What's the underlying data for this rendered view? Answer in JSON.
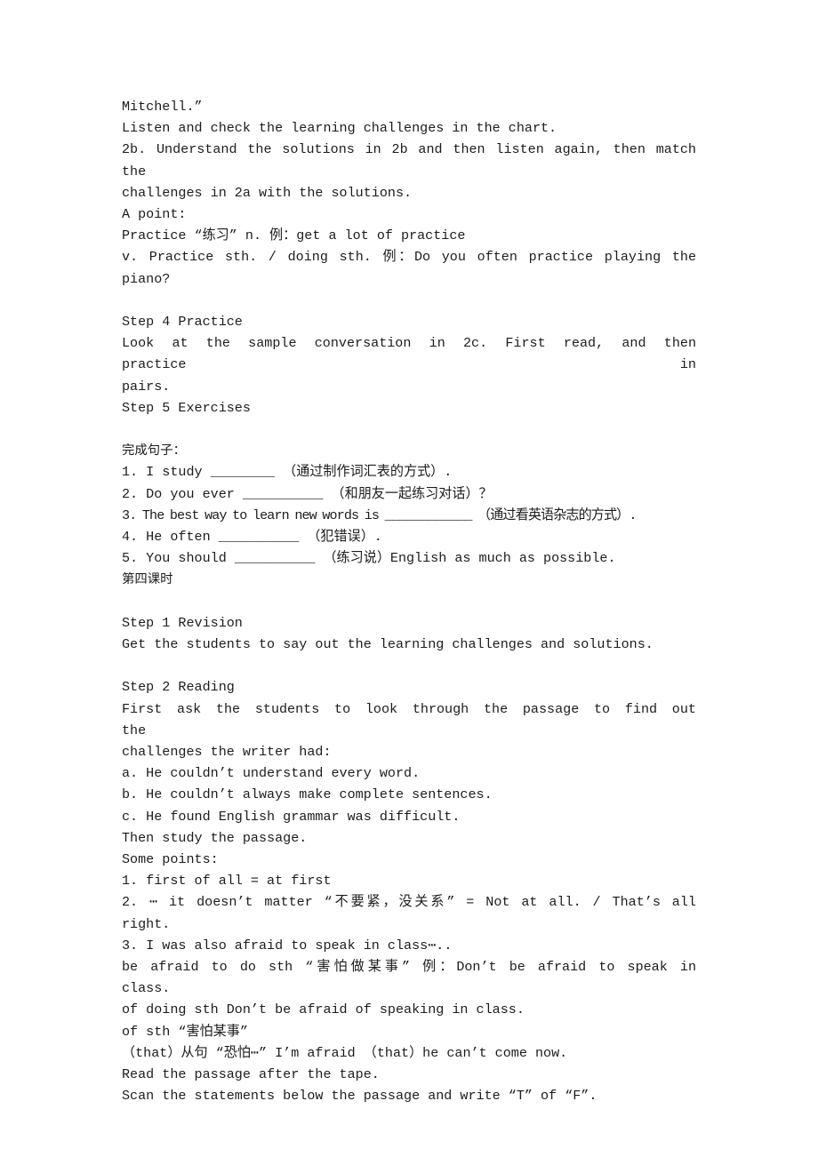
{
  "document": {
    "type": "lesson-plan",
    "language": "en-zh",
    "background_color": "#ffffff",
    "text_color": "#1c1c1c",
    "lines": [
      {
        "id": "l01",
        "text": "Mitchell.”",
        "style": "plain"
      },
      {
        "id": "l02",
        "text": "Listen and check the learning challenges in the chart.",
        "style": "plain"
      },
      {
        "id": "l03",
        "text": "2b. Understand the solutions in 2b and then listen again, then match the",
        "style": "justified-tight"
      },
      {
        "id": "l04",
        "text": "challenges in 2a with the solutions.",
        "style": "plain"
      },
      {
        "id": "l05",
        "text": "A point:",
        "style": "plain"
      },
      {
        "id": "l06",
        "text": "Practice “练习” n. 例：get a lot of practice",
        "style": "plain"
      },
      {
        "id": "l07",
        "text": "v. Practice sth. / doing sth. 例：Do you often practice playing the piano?",
        "style": "justified-tight"
      },
      {
        "id": "l08",
        "text": "",
        "style": "blank"
      },
      {
        "id": "l09",
        "text": "Step 4 Practice",
        "style": "plain"
      },
      {
        "id": "l10",
        "text": "Look at the sample conversation in 2c. First read, and then practice in",
        "style": "justified-wide"
      },
      {
        "id": "l11",
        "text": "pairs.",
        "style": "plain"
      },
      {
        "id": "l12",
        "text": "Step 5 Exercises",
        "style": "plain"
      },
      {
        "id": "l13",
        "text": "",
        "style": "blank"
      },
      {
        "id": "l14",
        "text": "完成句子：",
        "style": "cjk"
      },
      {
        "id": "l15",
        "text": "1. I study ________ （通过制作词汇表的方式）.",
        "style": "exercise",
        "number": "1."
      },
      {
        "id": "l16",
        "text": "2. Do you ever __________ （和朋友一起练习对话）？",
        "style": "exercise",
        "number": "2."
      },
      {
        "id": "l17",
        "text": "3. The best way to learn new words is ____________ （通过看英语杂志的方式）.",
        "style": "exercise-condensed",
        "number": "3."
      },
      {
        "id": "l18",
        "text": "4. He often __________ （犯错误）.",
        "style": "exercise",
        "number": "4."
      },
      {
        "id": "l19",
        "text": "5. You should __________ （练习说）English as much as possible.",
        "style": "exercise",
        "number": "5."
      },
      {
        "id": "l20",
        "text": "第四课时",
        "style": "cjk"
      },
      {
        "id": "l21",
        "text": "",
        "style": "blank"
      },
      {
        "id": "l22",
        "text": "Step 1 Revision",
        "style": "plain"
      },
      {
        "id": "l23",
        "text": "Get the students to say out the learning challenges and solutions.",
        "style": "plain"
      },
      {
        "id": "l24",
        "text": "",
        "style": "blank"
      },
      {
        "id": "l25",
        "text": "Step 2 Reading",
        "style": "plain"
      },
      {
        "id": "l26",
        "text": "First ask the students to look through the passage to find out the",
        "style": "justified-wide"
      },
      {
        "id": "l27",
        "text": "challenges the writer had:",
        "style": "plain"
      },
      {
        "id": "l28",
        "text": "a. He couldn’t understand every word.",
        "style": "plain"
      },
      {
        "id": "l29",
        "text": "b. He couldn’t always make complete sentences.",
        "style": "plain"
      },
      {
        "id": "l30",
        "text": "c. He found English grammar was difficult.",
        "style": "plain"
      },
      {
        "id": "l31",
        "text": "Then study the passage.",
        "style": "plain"
      },
      {
        "id": "l32",
        "text": "Some points:",
        "style": "plain"
      },
      {
        "id": "l33",
        "text": "1. first of all = at first",
        "style": "plain"
      },
      {
        "id": "l34",
        "text": "2. ⋯ it doesn’t matter “不要紧，没关系” = Not at all. / That’s all",
        "style": "justified-tight"
      },
      {
        "id": "l35",
        "text": "right.",
        "style": "plain"
      },
      {
        "id": "l36",
        "text": "3. I was also afraid to speak in class⋯..",
        "style": "plain"
      },
      {
        "id": "l37",
        "text": "be afraid to do sth “害怕做某事” 例：Don’t be afraid to speak in",
        "style": "justified-tight"
      },
      {
        "id": "l38",
        "text": "class.",
        "style": "plain"
      },
      {
        "id": "l39",
        "text": "of doing sth Don’t be afraid of speaking in class.",
        "style": "plain"
      },
      {
        "id": "l40",
        "text": "of sth “害怕某事”",
        "style": "plain"
      },
      {
        "id": "l41",
        "text": "（that）从句 “恐怕⋯” I’m afraid （that）he can’t come now.",
        "style": "plain"
      },
      {
        "id": "l42",
        "text": "Read the passage after the tape.",
        "style": "plain"
      },
      {
        "id": "l43",
        "text": "Scan the statements below the passage and write “T” of “F”.",
        "style": "plain"
      }
    ]
  }
}
